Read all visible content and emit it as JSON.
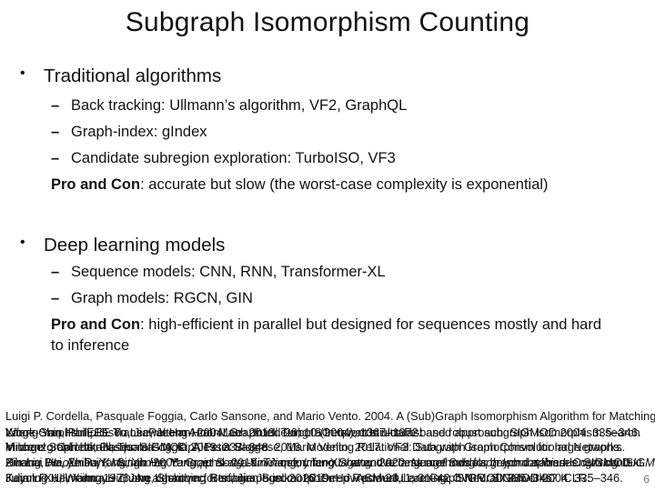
{
  "slide": {
    "title": "Subgraph Isomorphism Counting",
    "sections": [
      {
        "heading": "Traditional algorithms",
        "items": [
          "Back tracking: Ullmann’s algorithm, VF2, GraphQL",
          "Graph-index: gIndex",
          "Candidate subregion exploration: TurboISO, VF3"
        ],
        "pro_con_label": "Pro and Con",
        "pro_con_text": ": accurate but slow (the worst-case complexity is exponential)"
      },
      {
        "heading": "Deep learning models",
        "items": [
          "Sequence models: CNN, RNN, Transformer-XL",
          "Graph models: RGCN, GIN"
        ],
        "pro_con_label": "Pro and Con",
        "pro_con_text": ": high-efficient in parallel but designed for sequences mostly and hard to inference"
      }
    ],
    "bullet_glyph": "•",
    "dash_glyph": "–",
    "references": {
      "line1": "Luigi P. Cordella, Pasquale Foggia, Carlo Sansone, and Mario Vento. 2004. A (Sub)Graph Isomorphism Algorithm for Matching",
      "overlap_lines": [
        [
          "Large Graphs. IEEE Trans. Pattern Anal. Mach. Intell. 26, 10 (2004), 1367–1372.",
          "Wook-Shin Han, Jinsoo Lee, Jeong-Hoon Lee. 2013. TurboISO: towards ultrafast and robust subgraph isomorphism search",
          "Xifeng Yan, Philip S. Yu, Jiawei Han. 2004. Graph indexing: a frequent structure-based approach. SIGMOD 2004. 335–346."
        ],
        [
          "in large graph databases. SIGMOD 2013. 337–348.",
          "Vincenzo Carletti, Pasquale Foggia, Alessia Saggese, Mario Vento. 2017. VF3: Subgraph isomorphism for large graphs.",
          "Michael Schlichtkrull, Thomas N. Kipf, Peter Bloem. 2018. Modeling Relational Data with Graph Convolutional Networks."
        ],
        [
          "Xin Liu, Haojie Pan, Mutian He, Yangqiu Song, Xin Jiang, Lifeng Shang. 2020. Neural Subgraph Isomorphism Counting. SIGMOD.",
          "Zihang Dai, Zhilin Yang, Yiming Yang, et al. 2019. Transformer-XL: attentive language models beyond a fixed-length context.",
          "Huahai He, Ambuj K. Singh. 2008. Graphs-at-a-time: query language and access methods for graph databases. SIGMOD."
        ],
        [
          "Keyulu Xu, Weihua Hu, Jure Leskovec, Stefanie Jegelka. 2019. How powerful are Graph Neural Networks? ICLR.",
          "Kaiming He, Xiangyu Zhang, Shaoqing Ren, Jian Sun. 2016. Deep Residual Learning. CVPR. SIGMOD 2004. 335–346.",
          "Julian R. Ullmann. 1976. An algorithm for subgraph isomorphism. J. ACM 23, 1, 31–42. SIGMOD 335–346."
        ]
      ]
    },
    "page_number": "6"
  }
}
